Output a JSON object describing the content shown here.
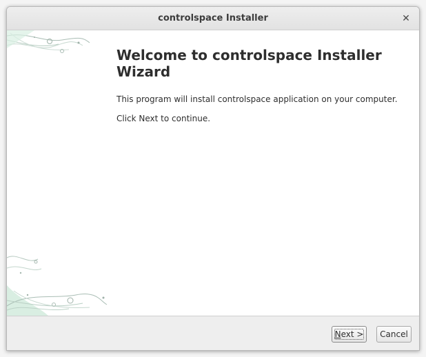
{
  "window": {
    "title": "controlspace Installer",
    "close_glyph": "✕"
  },
  "welcome": {
    "heading": "Welcome to controlspace Installer Wizard",
    "line1": "This program will install controlspace application on your computer.",
    "line2": "Click Next to continue."
  },
  "buttons": {
    "next_mnemonic": "N",
    "next_rest": "ext >",
    "cancel": "Cancel"
  },
  "colors": {
    "art_accent": "#9fd4b8",
    "art_line": "#a7b8b0"
  }
}
